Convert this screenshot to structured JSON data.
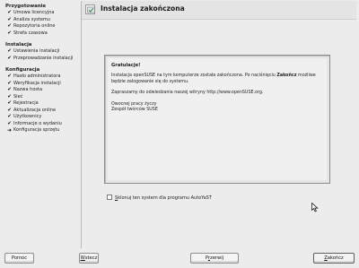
{
  "sidebar": {
    "sections": [
      {
        "title": "Przygotowanie",
        "items": [
          {
            "label": "Umowa licencyjna",
            "state": "done"
          },
          {
            "label": "Analiza systemu",
            "state": "done"
          },
          {
            "label": "Repozytoria online",
            "state": "done"
          },
          {
            "label": "Strefa czasowa",
            "state": "done"
          }
        ]
      },
      {
        "title": "Instalacja",
        "items": [
          {
            "label": "Ustawienia instalacji",
            "state": "done"
          },
          {
            "label": "Przeprowadzanie instalacji",
            "state": "done"
          }
        ]
      },
      {
        "title": "Konfiguracja",
        "items": [
          {
            "label": "Hasło administratora",
            "state": "done"
          },
          {
            "label": "Weryfikacja instalacji",
            "state": "done"
          },
          {
            "label": "Nazwa hosta",
            "state": "done"
          },
          {
            "label": "Sieć",
            "state": "done"
          },
          {
            "label": "Rejestracja",
            "state": "done"
          },
          {
            "label": "Aktualizacja online",
            "state": "done"
          },
          {
            "label": "Użytkownicy",
            "state": "done"
          },
          {
            "label": "Informacje o wydaniu",
            "state": "done"
          },
          {
            "label": "Konfiguracja sprzętu",
            "state": "current"
          }
        ]
      }
    ]
  },
  "header": {
    "title": "Instalacja zakończona"
  },
  "message": {
    "title": "Gratulacje!",
    "p1_before": "Instalacja openSUSE na tym komputerze została zakończona. Po naciśnięciu ",
    "p1_bold": "Zakończ",
    "p1_after": " możliwe będzie zalogowanie się do systemu.",
    "p2": "Zapraszamy do odwiedzania naszej witryny http://www.openSUSE.org.",
    "p3_line1": "Owocnej pracy życzy",
    "p3_line2": "Zespół twórców SUSE"
  },
  "clone_checkbox": {
    "label_accel": "S",
    "label_rest": "klonuj ten system dla programu AutoYaST",
    "checked": false
  },
  "buttons": {
    "help": "Pomoc",
    "back_accel": "W",
    "back_rest": "stecz",
    "abort_before": "P",
    "abort_accel": "r",
    "abort_rest": "zerwij",
    "finish_accel": "Z",
    "finish_rest": "akończ"
  },
  "icons": {
    "done_mark": "checkmark-icon",
    "current_mark": "arrow-right-icon",
    "header_icon": "installation-icon"
  }
}
